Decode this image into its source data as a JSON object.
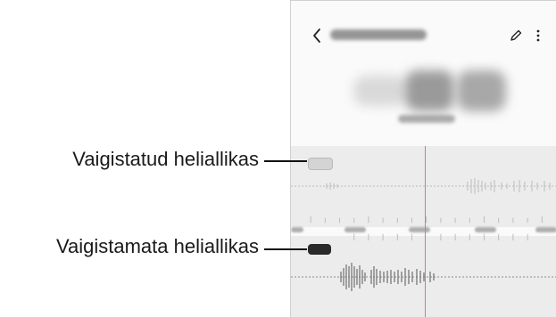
{
  "callouts": {
    "muted_source_label": "Vaigistatud heliallikas",
    "unmuted_source_label": "Vaigistamata heliallikas"
  },
  "icons": {
    "back": "chevron-left-icon",
    "edit": "pencil-icon",
    "more": "more-vertical-icon"
  },
  "colors": {
    "playhead": "#e57373",
    "muted_source": "#d4d4d4",
    "unmuted_source": "#2a2a2a"
  }
}
